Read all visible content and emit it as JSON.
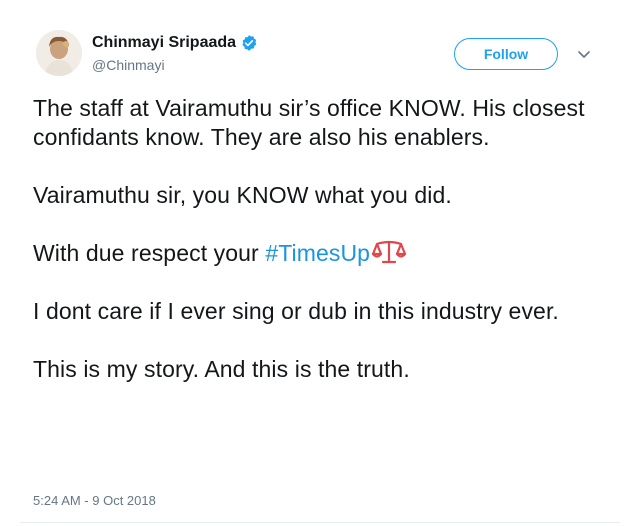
{
  "author": {
    "display_name": "Chinmayi Sripaada",
    "handle": "@Chinmayi",
    "verified": true,
    "avatar_icon": "profile-photo"
  },
  "actions": {
    "follow_label": "Follow",
    "menu_icon": "chevron-down-icon"
  },
  "tweet": {
    "para1": "The staff at Vairamuthu sir’s office KNOW. His closest confidants know. They are also his enablers.",
    "para2": "Vairamuthu sir, you KNOW what you did.",
    "para3_prefix": "With due respect your ",
    "hashtag": "#TimesUp",
    "hashtag_emoji": "scales-icon",
    "para4": "I dont care if I ever sing or dub in this industry ever.",
    "para5": "This is my story. And this is the truth.",
    "timestamp": "5:24 AM - 9 Oct 2018"
  },
  "colors": {
    "accent": "#1da1f2",
    "hashtag": "#1b95e0",
    "secondary_text": "#657786",
    "emoji": "#e0474c"
  }
}
